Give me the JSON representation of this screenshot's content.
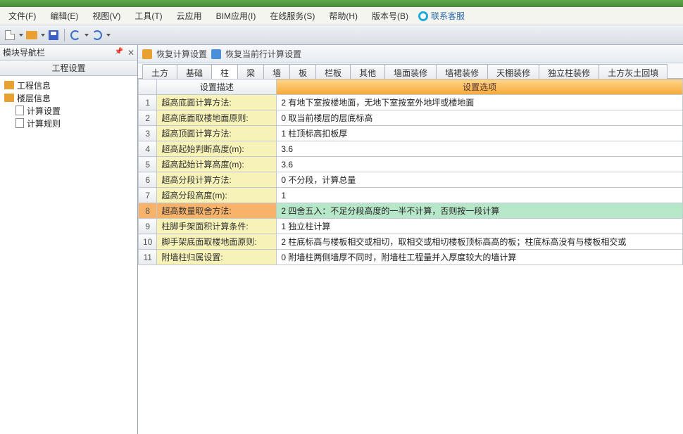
{
  "menu": {
    "file": "文件(F)",
    "edit": "编辑(E)",
    "view": "视图(V)",
    "tool": "工具(T)",
    "cloud": "云应用",
    "bim": "BIM应用(I)",
    "online": "在线服务(S)",
    "help": "帮助(H)",
    "version": "版本号(B)",
    "kefu": "联系客服"
  },
  "sidebar": {
    "title": "模块导航栏",
    "section": "工程设置",
    "items": [
      {
        "label": "工程信息"
      },
      {
        "label": "楼层信息"
      },
      {
        "label": "计算设置"
      },
      {
        "label": "计算规则"
      }
    ]
  },
  "content_toolbar": {
    "btn1": "恢复计算设置",
    "btn2": "恢复当前行计算设置"
  },
  "tabs": [
    "土方",
    "基础",
    "柱",
    "梁",
    "墙",
    "板",
    "栏板",
    "其他",
    "墙面装修",
    "墙裙装修",
    "天棚装修",
    "独立柱装修",
    "土方灰土回填"
  ],
  "active_tab_index": 2,
  "grid": {
    "header": {
      "desc": "设置描述",
      "opt": "设置选项"
    },
    "selected_row": 8,
    "rows": [
      {
        "n": 1,
        "desc": "超高底面计算方法:",
        "opt": "2 有地下室按楼地面，无地下室按室外地坪或楼地面"
      },
      {
        "n": 2,
        "desc": "超高底面取楼地面原则:",
        "opt": "0 取当前楼层的层底标高"
      },
      {
        "n": 3,
        "desc": "超高顶面计算方法:",
        "opt": "1 柱顶标高扣板厚"
      },
      {
        "n": 4,
        "desc": "超高起始判断高度(m):",
        "opt": "3.6"
      },
      {
        "n": 5,
        "desc": "超高起始计算高度(m):",
        "opt": "3.6"
      },
      {
        "n": 6,
        "desc": "超高分段计算方法:",
        "opt": "0 不分段，计算总量"
      },
      {
        "n": 7,
        "desc": "超高分段高度(m):",
        "opt": "1"
      },
      {
        "n": 8,
        "desc": "超高数量取舍方法:",
        "opt": "2 四舍五入：不足分段高度的一半不计算，否则按一段计算"
      },
      {
        "n": 9,
        "desc": "柱脚手架面积计算条件:",
        "opt": "1 独立柱计算"
      },
      {
        "n": 10,
        "desc": "脚手架底面取楼地面原则:",
        "opt": "2 柱底标高与楼板相交或相切，取相交或相切楼板顶标高高的板；柱底标高没有与楼板相交或"
      },
      {
        "n": 11,
        "desc": "附墙柱归属设置:",
        "opt": "0 附墙柱两侧墙厚不同时，附墙柱工程量并入厚度较大的墙计算"
      }
    ]
  }
}
